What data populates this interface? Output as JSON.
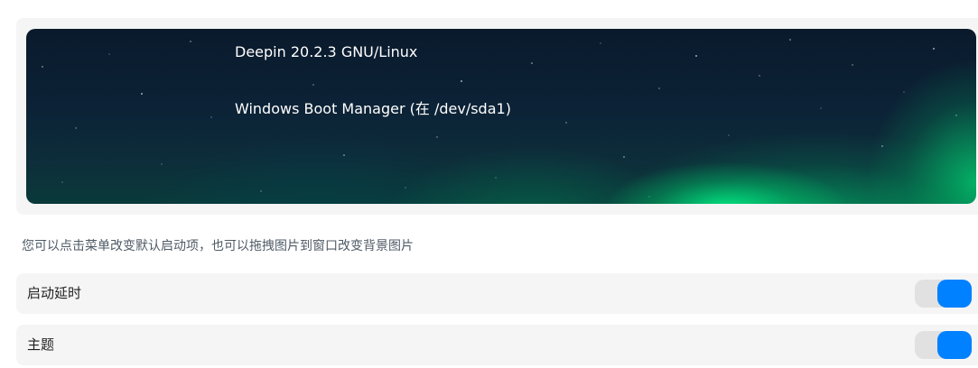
{
  "boot_menu": {
    "entries": [
      "Deepin 20.2.3 GNU/Linux",
      "Windows Boot Manager (在 /dev/sda1)"
    ]
  },
  "hint": "您可以点击菜单改变默认启动项，也可以拖拽图片到窗口改变背景图片",
  "settings": [
    {
      "label": "启动延时",
      "enabled": true
    },
    {
      "label": "主题",
      "enabled": true
    }
  ],
  "colors": {
    "accent": "#0081ff",
    "row_background": "#f5f5f5",
    "toggle_track": "#e1e1e1"
  }
}
